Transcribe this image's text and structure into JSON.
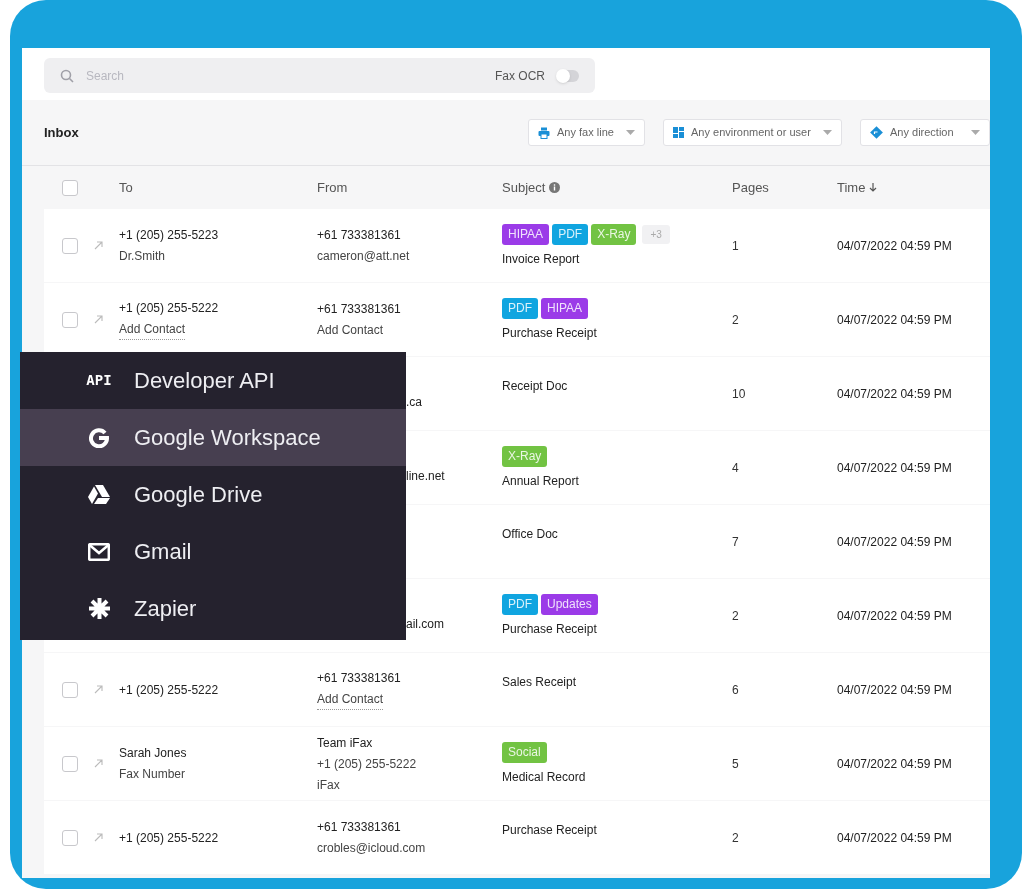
{
  "search": {
    "placeholder": "Search",
    "ocr_label": "Fax OCR",
    "ocr_on": false
  },
  "inbox": {
    "title": "Inbox",
    "filters": [
      {
        "kind": "fax_line",
        "label": "Any fax line"
      },
      {
        "kind": "environment",
        "label": "Any environment or user"
      },
      {
        "kind": "direction",
        "label": "Any direction"
      }
    ]
  },
  "table": {
    "all_checked": false,
    "columns": [
      {
        "label": "To"
      },
      {
        "label": "From"
      },
      {
        "label": "Subject",
        "info": true
      },
      {
        "label": "Pages"
      },
      {
        "label": "Time",
        "sorted": true
      }
    ],
    "rows": [
      {
        "checked": false,
        "to": [
          {
            "text": "+1 (205) 255-5223",
            "link": false
          },
          {
            "text": "Dr.Smith",
            "link": false
          }
        ],
        "from": [
          {
            "text": "+61 733381361",
            "link": false
          },
          {
            "text": "cameron@att.net",
            "link": false
          }
        ],
        "tags": [
          {
            "label": "HIPAA",
            "color": "#9b3be8"
          },
          {
            "label": "PDF",
            "color": "#10a5e0"
          },
          {
            "label": "X-Ray",
            "color": "#72c343"
          }
        ],
        "more": "+3",
        "subject": "Invoice Report",
        "pages": "1",
        "time": "04/07/2022 04:59 PM"
      },
      {
        "checked": false,
        "to": [
          {
            "text": "+1 (205) 255-5222",
            "link": false
          },
          {
            "text": "Add Contact",
            "link": true
          }
        ],
        "from": [
          {
            "text": "+61 733381361",
            "link": false
          },
          {
            "text": "Add Contact",
            "link": false
          }
        ],
        "tags": [
          {
            "label": "PDF",
            "color": "#10a5e0"
          },
          {
            "label": "HIPAA",
            "color": "#9b3be8"
          }
        ],
        "subject": "Purchase Receipt",
        "pages": "2",
        "time": "04/07/2022 04:59 PM"
      },
      {
        "from": [
          {
            "text": ".ca",
            "link": false
          }
        ],
        "subject": "Receipt Doc",
        "pages": "10",
        "time": "04/07/2022 04:59 PM"
      },
      {
        "from": [
          {
            "text": "line.net",
            "link": false
          }
        ],
        "tags": [
          {
            "label": "X-Ray",
            "color": "#72c343"
          }
        ],
        "subject": "Annual Report",
        "pages": "4",
        "time": "04/07/2022 04:59 PM"
      },
      {
        "subject": "Office Doc",
        "pages": "7",
        "time": "04/07/2022 04:59 PM"
      },
      {
        "from": [
          {
            "text": "ail.com",
            "link": false
          }
        ],
        "tags": [
          {
            "label": "PDF",
            "color": "#10a5e0"
          },
          {
            "label": "Updates",
            "color": "#9b3be8"
          }
        ],
        "subject": "Purchase Receipt",
        "pages": "2",
        "time": "04/07/2022 04:59 PM"
      },
      {
        "checked": false,
        "to": [
          {
            "text": "+1 (205) 255-5222",
            "link": false
          }
        ],
        "from": [
          {
            "text": "+61 733381361",
            "link": false
          },
          {
            "text": "Add Contact",
            "link": true
          }
        ],
        "subject": "Sales Receipt",
        "pages": "6",
        "time": "04/07/2022 04:59 PM"
      },
      {
        "checked": false,
        "to": [
          {
            "text": "Sarah Jones",
            "link": false
          },
          {
            "text": "Fax Number",
            "link": false
          }
        ],
        "from": [
          {
            "text": "Team iFax",
            "link": false
          },
          {
            "text": "+1 (205) 255-5222",
            "link": false
          },
          {
            "text": "iFax",
            "link": false
          }
        ],
        "tags": [
          {
            "label": "Social",
            "color": "#72c343"
          }
        ],
        "subject": "Medical Record",
        "pages": "5",
        "time": "04/07/2022 04:59 PM"
      },
      {
        "checked": false,
        "to": [
          {
            "text": "+1 (205) 255-5222",
            "link": false
          }
        ],
        "from": [
          {
            "text": "+61 733381361",
            "link": false
          },
          {
            "text": "crobles@icloud.com",
            "link": false
          }
        ],
        "subject": "Purchase Receipt",
        "pages": "2",
        "time": "04/07/2022 04:59 PM"
      }
    ]
  },
  "integrations_menu": {
    "items": [
      {
        "kind": "api",
        "icon_text": "API",
        "label": "Developer API",
        "selected": false
      },
      {
        "kind": "workspace",
        "label": "Google Workspace",
        "selected": true
      },
      {
        "kind": "drive",
        "label": "Google Drive",
        "selected": false
      },
      {
        "kind": "gmail",
        "label": "Gmail",
        "selected": false
      },
      {
        "kind": "zapier",
        "label": "Zapier",
        "selected": false
      }
    ]
  }
}
